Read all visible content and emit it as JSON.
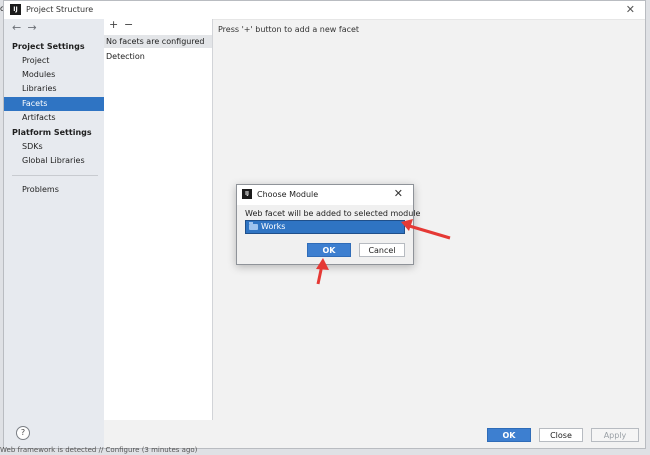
{
  "window": {
    "title": "Project Structure",
    "app_icon_text": "IJ",
    "edge_clip": "c"
  },
  "sidebar": {
    "sections": [
      {
        "header": "Project Settings",
        "items": [
          "Project",
          "Modules",
          "Libraries",
          "Facets",
          "Artifacts"
        ]
      },
      {
        "header": "Platform Settings",
        "items": [
          "SDKs",
          "Global Libraries"
        ]
      }
    ],
    "extra_items": [
      "Problems"
    ],
    "active_item": "Facets",
    "back_icon": "←",
    "forward_icon": "→",
    "help_label": "?"
  },
  "facet_panel": {
    "add_icon": "+",
    "remove_icon": "−",
    "rows": [
      "No facets are configured",
      "Detection"
    ]
  },
  "content": {
    "hint": "Press '+' button to add a new facet"
  },
  "buttons": {
    "ok": "OK",
    "close": "Close",
    "apply": "Apply"
  },
  "dialog": {
    "title": "Choose Module",
    "message": "Web facet will be added to selected module",
    "module": "Works",
    "ok": "OK",
    "cancel": "Cancel"
  },
  "status_text": "Web framework is detected // Configure (3 minutes ago)",
  "colors": {
    "accent": "#2f74c3",
    "primary_button": "#3d7fd0",
    "arrow": "#e53935"
  }
}
